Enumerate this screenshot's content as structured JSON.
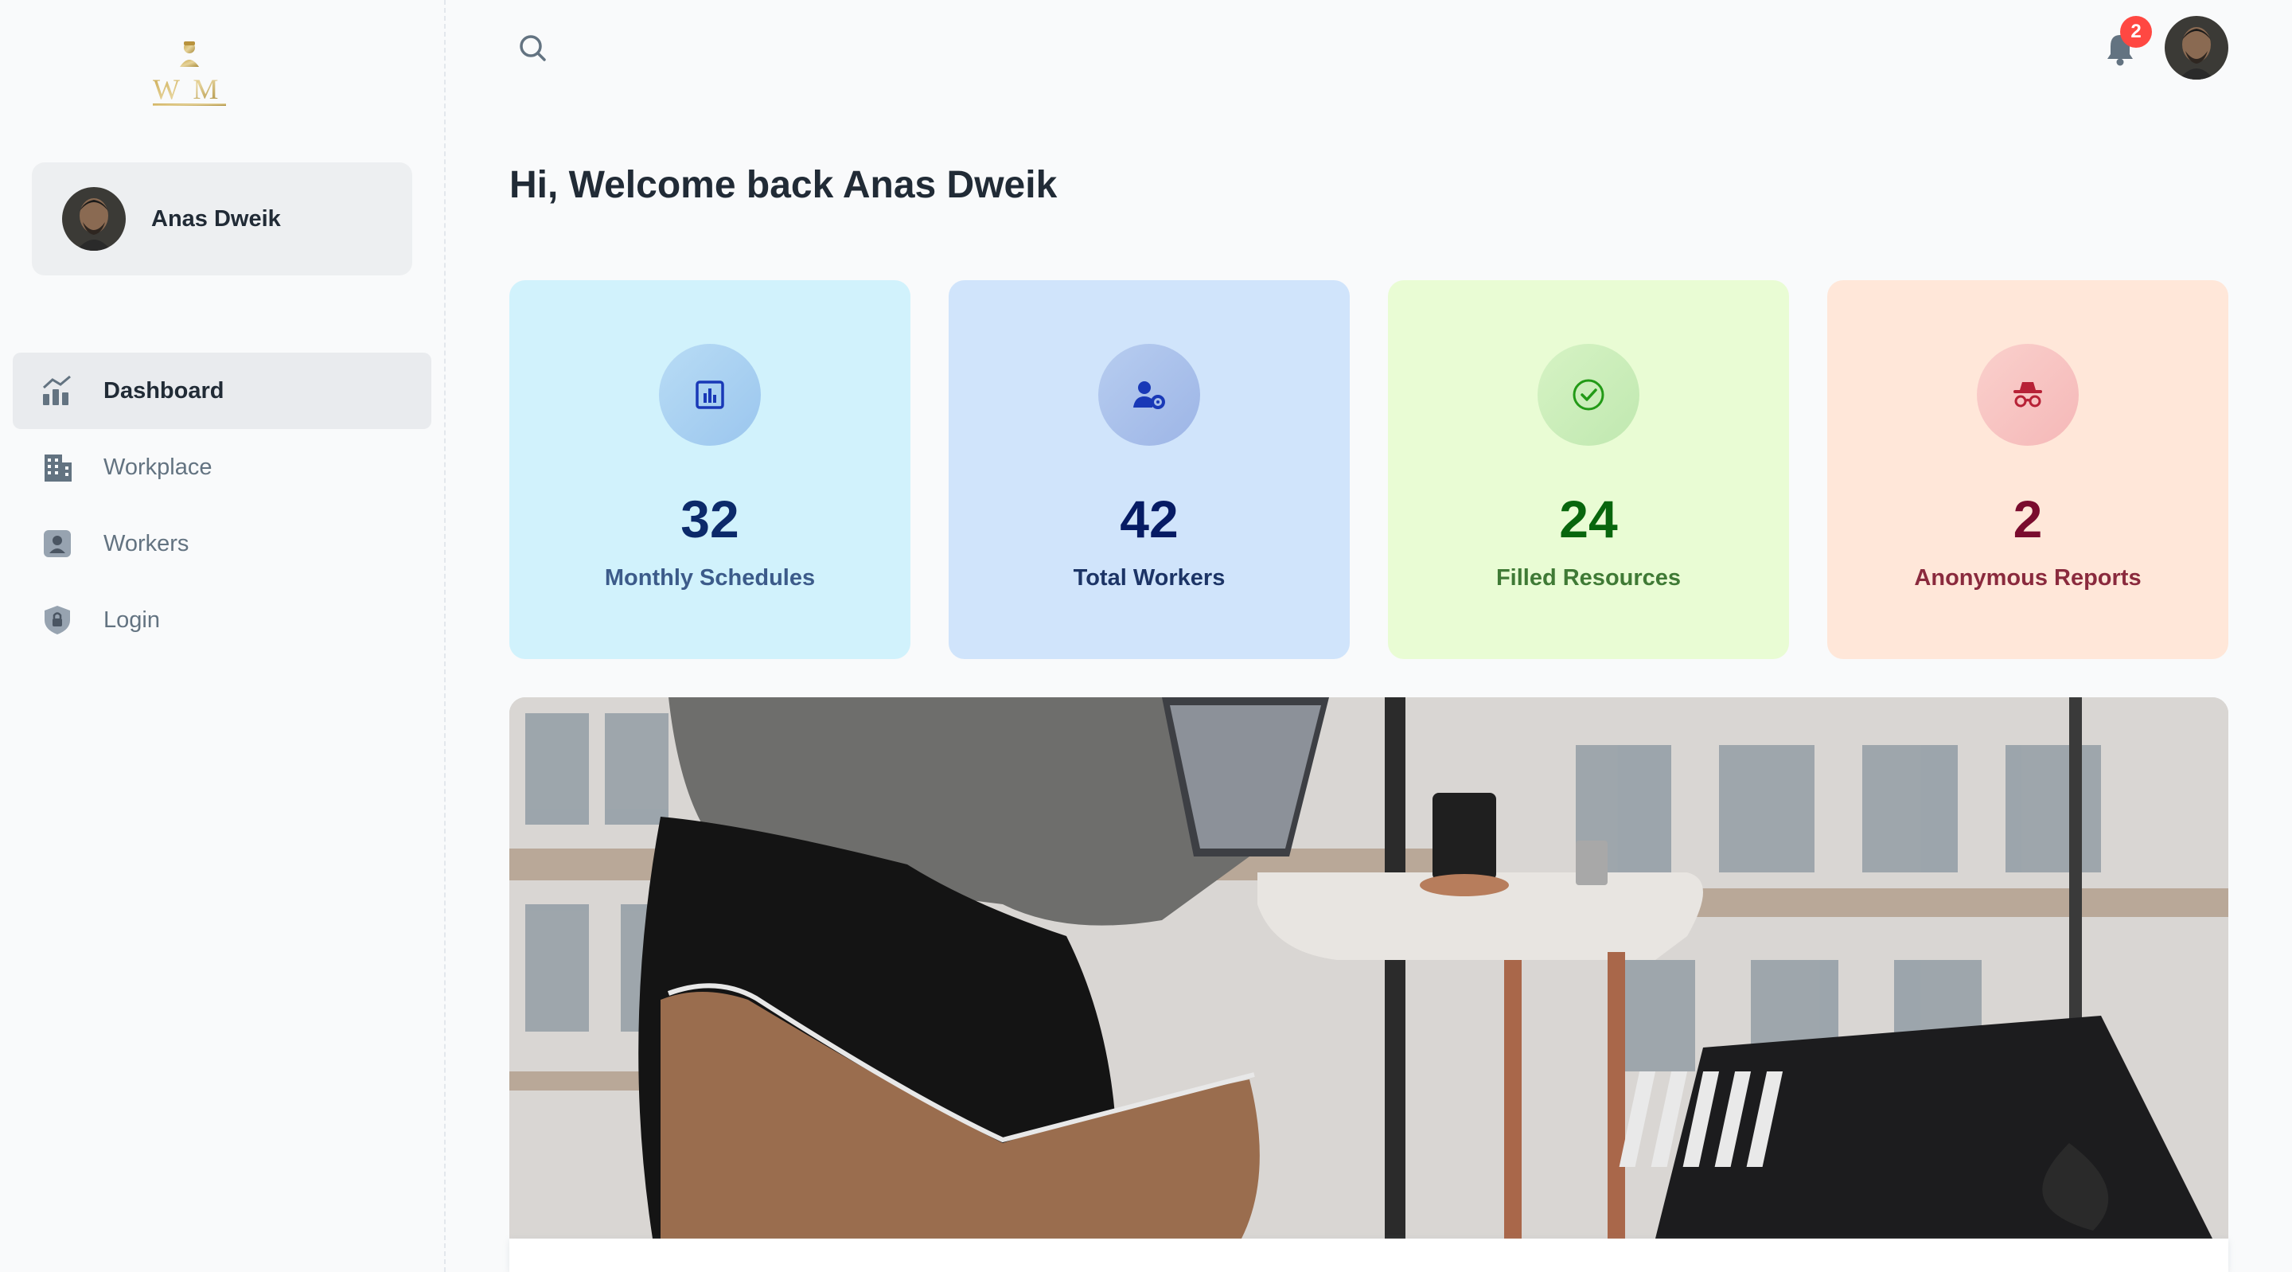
{
  "user": {
    "name": "Anas Dweik"
  },
  "sidebar": {
    "items": [
      {
        "label": "Dashboard",
        "icon": "analytics-icon",
        "active": true
      },
      {
        "label": "Workplace",
        "icon": "building-icon",
        "active": false
      },
      {
        "label": "Workers",
        "icon": "person-badge-icon",
        "active": false
      },
      {
        "label": "Login",
        "icon": "shield-lock-icon",
        "active": false
      }
    ]
  },
  "header": {
    "notification_count": "2"
  },
  "main": {
    "welcome": "Hi, Welcome back Anas Dweik",
    "cards": [
      {
        "value": "32",
        "label": "Monthly Schedules",
        "icon": "bar-chart-icon",
        "bg": "#d1f2fc",
        "fg": "#0c2a6a"
      },
      {
        "value": "42",
        "label": "Total Workers",
        "icon": "user-gear-icon",
        "bg": "#d0e4fb",
        "fg": "#061b64"
      },
      {
        "value": "24",
        "label": "Filled Resources",
        "icon": "check-circle-icon",
        "bg": "#e9fcd4",
        "fg": "#08660d"
      },
      {
        "value": "2",
        "label": "Anonymous Reports",
        "icon": "incognito-icon",
        "bg": "#ffe7d9",
        "fg": "#7a0c2e"
      }
    ]
  },
  "colors": {
    "accent": "#212b36",
    "badge": "#ff4842",
    "sidebar_active": "#e9ebee"
  }
}
